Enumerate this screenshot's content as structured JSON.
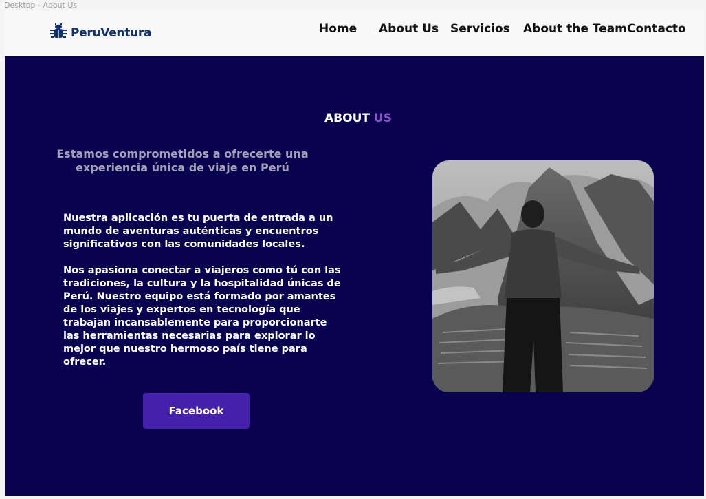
{
  "frame_label": "Desktop - About Us",
  "brand": {
    "name": "PeruVentura",
    "icon": "bug-logo-icon"
  },
  "nav": {
    "items": [
      {
        "label": "Home"
      },
      {
        "label": "About Us"
      },
      {
        "label": "Servicios"
      },
      {
        "label": "About the Team"
      },
      {
        "label": "Contacto"
      }
    ]
  },
  "about": {
    "heading_main": "ABOUT",
    "heading_accent": "US",
    "tagline": "Estamos comprometidos a ofrecerte una experiencia única de viaje en Perú",
    "paragraph_1": "Nuestra aplicación es tu puerta de entrada a un mundo de aventuras auténticas y encuentros significativos con las comunidades locales.",
    "paragraph_2": "Nos apasiona conectar a viajeros como tú con las tradiciones, la cultura y la hospitalidad únicas de Perú. Nuestro equipo está formado por amantes de los viajes y expertos en tecnología que trabajan incansablemente para proporcionarte las herramientas necesarias para explorar lo mejor que nuestro hermoso país tiene para ofrecer.",
    "facebook_button": "Facebook",
    "photo": "traveler-at-machu-picchu-photo"
  },
  "colors": {
    "hero_background": "#0a0050",
    "accent": "#8b55c9",
    "button": "#4520ac",
    "brand": "#12326b"
  }
}
